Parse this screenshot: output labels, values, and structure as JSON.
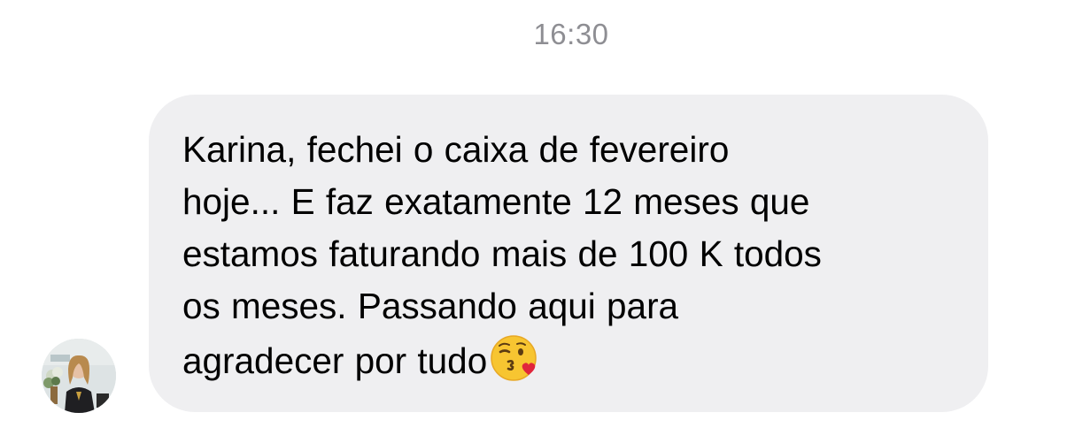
{
  "chat": {
    "timestamp": "16:30",
    "message": {
      "text": "Karina, fechei o caixa de fevereiro\nhoje... E faz exatamente 12 meses que\nestamos faturando mais de 100 K todos\nos meses. Passando aqui para\nagradecer por tudo",
      "emoji": "face-blowing-kiss-emoji"
    },
    "sender_avatar": "avatar-photo"
  },
  "colors": {
    "bubble": "#efeff1",
    "timestamp": "#8e8e93",
    "text": "#000000"
  }
}
